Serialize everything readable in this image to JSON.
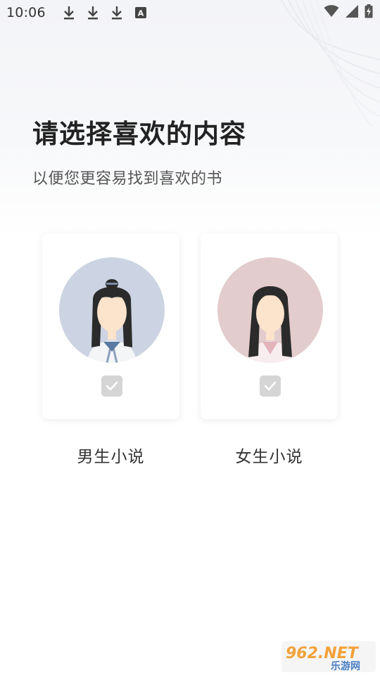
{
  "status_bar": {
    "time": "10:06",
    "icons": [
      "download-icon",
      "download-icon",
      "download-icon",
      "font-a-icon",
      "wifi-icon",
      "signal-icon",
      "battery-charging-icon"
    ],
    "badge_letter": "A"
  },
  "header": {
    "title": "请选择喜欢的内容",
    "subtitle": "以便您更容易找到喜欢的书"
  },
  "options": [
    {
      "id": "male",
      "label": "男生小说",
      "avatar_bg": "#ccd3e2",
      "selected": false
    },
    {
      "id": "female",
      "label": "女生小说",
      "avatar_bg": "#e3cccd",
      "selected": false
    }
  ],
  "colors": {
    "check_bg": "#d5d5d5",
    "title": "#222222",
    "subtitle": "#555555"
  },
  "watermark": {
    "main": "962.NET",
    "sub": "乐游网"
  }
}
